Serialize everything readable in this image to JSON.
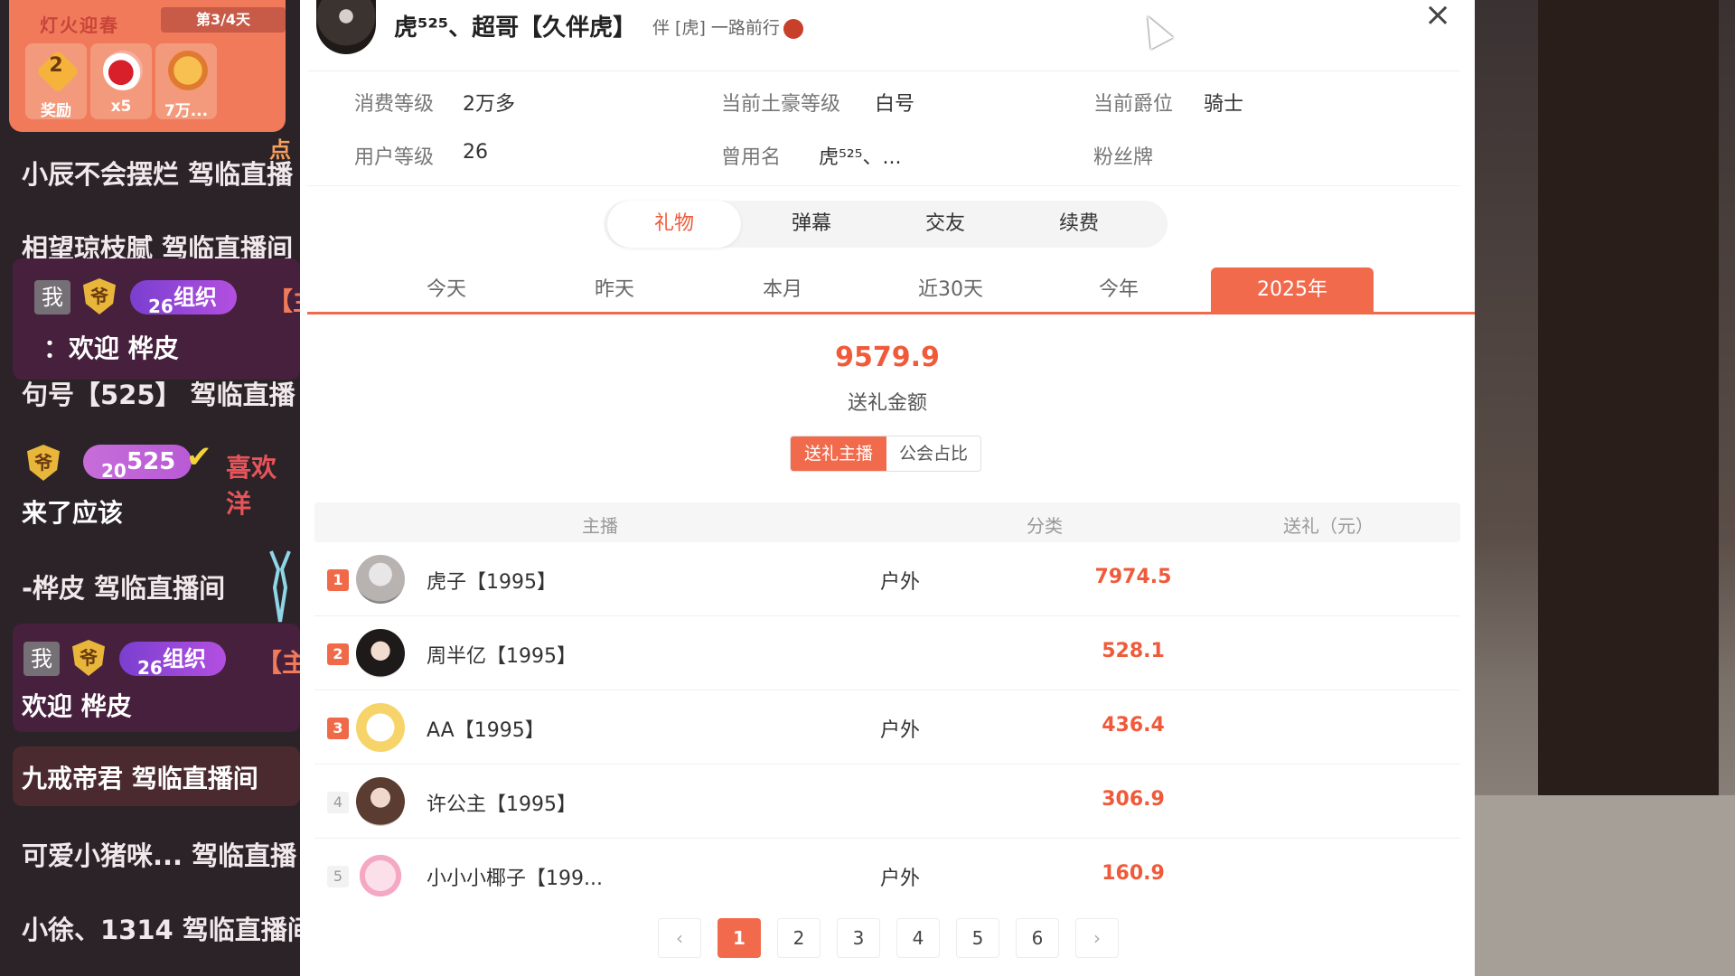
{
  "chat": {
    "gift_card": {
      "event_title": "灯火迎春",
      "day_label": "第3/4天",
      "slots": [
        {
          "icon": "reward-badge-icon",
          "badge": "2",
          "label": "奖励"
        },
        {
          "icon": "cherry-gift-icon",
          "label": "x5"
        },
        {
          "icon": "coin-gift-icon",
          "label": "7万..."
        }
      ]
    },
    "click_hint": "点",
    "lines": [
      {
        "text": "小辰不会摆烂 驾临直播"
      },
      {
        "text": "相望琼枝腻 驾临直播间"
      },
      {
        "me": "我",
        "shield": "爷",
        "org_level": "26",
        "org_label": "组织",
        "bracket": "【主",
        "message": "：欢迎 桦皮"
      },
      {
        "text": "句号【525】 驾临直播"
      },
      {
        "shield": "爷",
        "fans_level": "20",
        "fans_label": "525",
        "extra": "喜欢洋",
        "message": "来了应该"
      },
      {
        "text": "-桦皮 驾临直播间"
      },
      {
        "me": "我",
        "shield": "爷",
        "org_level": "26",
        "org_label": "组织",
        "bracket": "【主",
        "message": "欢迎 桦皮"
      },
      {
        "text": "九戒帝君 驾临直播间"
      },
      {
        "text": "可爱小猪咪... 驾临直播"
      },
      {
        "text": "小徐、1314 驾临直播间"
      }
    ]
  },
  "popup": {
    "user_name": "虎⁵²⁵、超哥【久伴虎】",
    "user_tag": "伴 [虎] 一路前行",
    "close_label": "×",
    "info": {
      "row1": [
        {
          "key": "消费等级",
          "value": "2万多"
        },
        {
          "key": "当前土豪等级",
          "value": "白号"
        },
        {
          "key": "当前爵位",
          "value": "骑士"
        }
      ],
      "row2": [
        {
          "key": "用户等级",
          "value": "26"
        },
        {
          "key": "曾用名",
          "value": "虎⁵²⁵、..."
        },
        {
          "key": "粉丝牌",
          "value": ""
        }
      ]
    },
    "segments": [
      "礼物",
      "弹幕",
      "交友",
      "续费"
    ],
    "active_segment": 0,
    "periods": [
      "今天",
      "昨天",
      "本月",
      "近30天",
      "今年",
      "2025年"
    ],
    "active_period": 5,
    "total_value": "9579.9",
    "total_label": "送礼金额",
    "toggles": [
      "送礼主播",
      "公会占比"
    ],
    "active_toggle": 0,
    "table": {
      "headers": [
        "主播",
        "分类",
        "送礼（元）"
      ],
      "rows": [
        {
          "rank": "1",
          "name": "虎子【1995】",
          "category": "户外",
          "amount": "7974.5"
        },
        {
          "rank": "2",
          "name": "周半亿【1995】",
          "category": "",
          "amount": "528.1"
        },
        {
          "rank": "3",
          "name": "AA【1995】",
          "category": "户外",
          "amount": "436.4"
        },
        {
          "rank": "4",
          "name": "许公主【1995】",
          "category": "",
          "amount": "306.9"
        },
        {
          "rank": "5",
          "name": "小小小椰子【199...",
          "category": "户外",
          "amount": "160.9"
        }
      ]
    },
    "pagination": {
      "prev": "‹",
      "pages": [
        "1",
        "2",
        "3",
        "4",
        "5",
        "6"
      ],
      "active": "1",
      "next": "›"
    }
  },
  "colors": {
    "accent": "#f26a4c",
    "amount_red": "#f05a3a",
    "chat_bg": "#2b2327",
    "gift_card": "#f07a5a"
  }
}
